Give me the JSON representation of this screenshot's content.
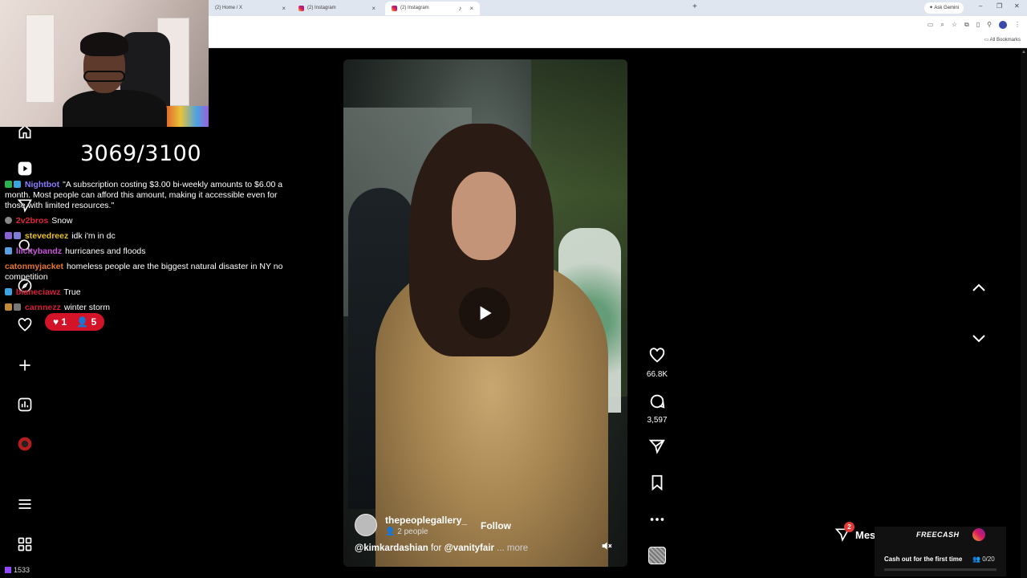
{
  "browser": {
    "tabs": [
      {
        "label": "(2) Home / X",
        "active": false
      },
      {
        "label": "(2) Instagram",
        "active": false
      },
      {
        "label": "(2) Instagram",
        "active": true
      }
    ],
    "ask_gemini": "Ask Gemini",
    "all_bookmarks": "All Bookmarks"
  },
  "stream": {
    "goal_counter": "3069/3100",
    "chat": [
      {
        "user": "Nightbot",
        "user_color": "#8a7cff",
        "message": "\"A subscription costing $3.00 bi-weekly amounts to $6.00 a month. Most people can afford this amount, making it accessible even for those with limited resources.\""
      },
      {
        "user": "2v2bros",
        "user_color": "#e0243a",
        "message": "Snow"
      },
      {
        "user": "stevedreez",
        "user_color": "#e8c22a",
        "message": "idk i'm in dc"
      },
      {
        "user": "lilcitybandz",
        "user_color": "#c657d8",
        "message": "hurricanes and floods"
      },
      {
        "user": "catonmyjacket",
        "user_color": "#e6772a",
        "message": "homeless people are the biggest natural disaster in NY no competition"
      },
      {
        "user": "bianeciawz",
        "user_color": "#d61f3a",
        "message": "True"
      },
      {
        "user": "carnnezz",
        "user_color": "#d61f3a",
        "message": "winter storm"
      }
    ],
    "likes": "1",
    "viewers": "5"
  },
  "left_nav": {
    "count": "1533"
  },
  "reel": {
    "author": "thepeoplegallery_",
    "collaborators": "2 people",
    "follow_label": "Follow",
    "caption_mention_1": "@kimkardashian",
    "caption_word": "for",
    "caption_mention_2": "@vanityfair",
    "caption_more": "... more",
    "likes": "66.8K",
    "comments": "3,597"
  },
  "messages": {
    "label": "Messages",
    "badge": "2"
  },
  "freecash": {
    "logo": "FREECASH",
    "text": "Cash out for the first time",
    "progress": "0/20",
    "progress_fraction": 0
  },
  "colors": {
    "accent_red": "#d31327",
    "page_bg": "#000000",
    "tab_bar": "#dfe6f0"
  }
}
